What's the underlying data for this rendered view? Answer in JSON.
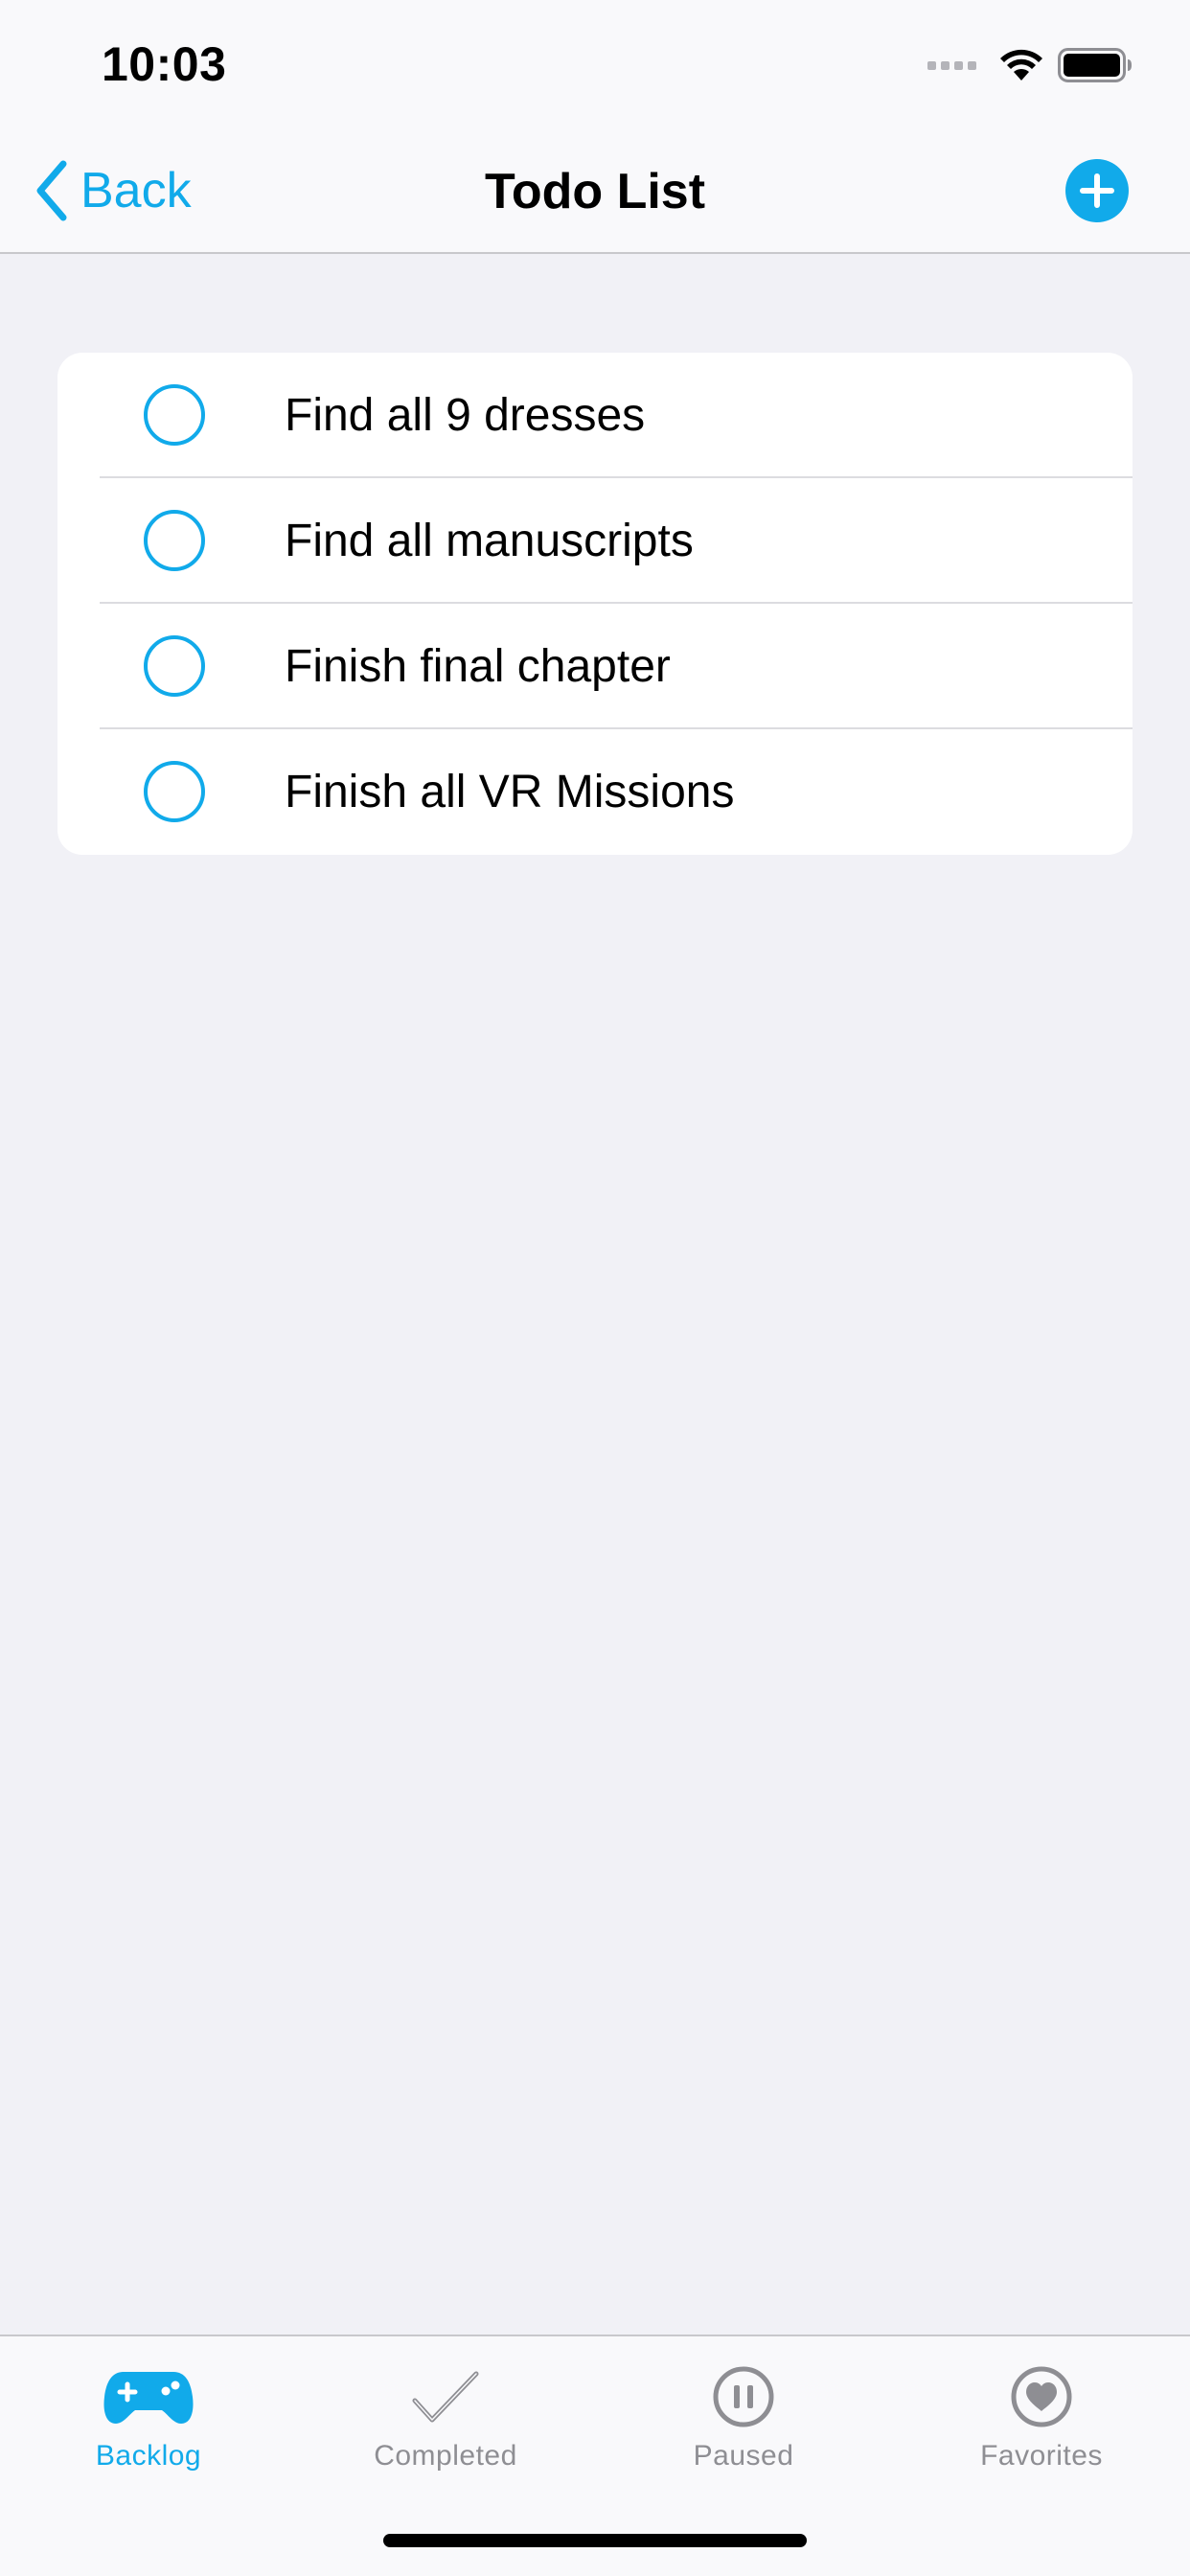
{
  "status_bar": {
    "time": "10:03"
  },
  "nav": {
    "back_label": "Back",
    "title": "Todo List",
    "add_icon": "plus-circle-icon"
  },
  "todo_items": [
    {
      "label": "Find all 9 dresses",
      "completed": false
    },
    {
      "label": "Find all manuscripts",
      "completed": false
    },
    {
      "label": "Finish final chapter",
      "completed": false
    },
    {
      "label": "Finish all VR Missions",
      "completed": false
    }
  ],
  "tabs": [
    {
      "label": "Backlog",
      "icon": "gamepad-icon",
      "active": true
    },
    {
      "label": "Completed",
      "icon": "checkmark-icon",
      "active": false
    },
    {
      "label": "Paused",
      "icon": "pause-circle-icon",
      "active": false
    },
    {
      "label": "Favorites",
      "icon": "heart-circle-icon",
      "active": false
    }
  ],
  "colors": {
    "accent": "#11aaea",
    "background": "#f1f1f6",
    "inactive_tab": "#8e8e93"
  }
}
